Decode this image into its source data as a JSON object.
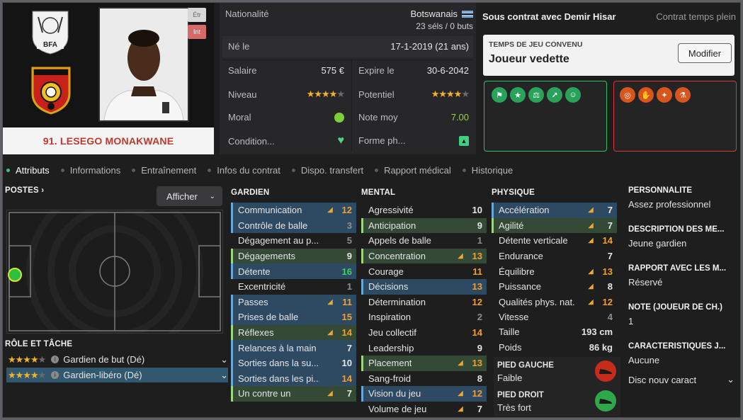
{
  "player": {
    "name": "91. LESEGO MONAKWANE",
    "tag_etr": "Étr",
    "tag_int": "Int",
    "nationality_label": "Nationalité",
    "nationality": "Botswanais",
    "caps": "23 séls / 0 buts",
    "born_label": "Né le",
    "born": "17-1-2019 (21 ans)",
    "salary_label": "Salaire",
    "salary": "575 €",
    "expires_label": "Expire le",
    "expires": "30-6-2042",
    "level_label": "Niveau",
    "level_stars": 4,
    "potential_label": "Potentiel",
    "potential_stars": 4,
    "morale_label": "Moral",
    "avg_label": "Note moy",
    "avg": "7.00",
    "condition_label": "Condition...",
    "form_label": "Forme ph..."
  },
  "badges": {
    "bfa": "BFA"
  },
  "contract": {
    "club": "Sous contrat avec Demir Hisar",
    "type": "Contrat temps plein",
    "playtime_title": "TEMPS DE JEU CONVENU",
    "playtime": "Joueur vedette",
    "modify": "Modifier"
  },
  "tabs": [
    "Attributs",
    "Informations",
    "Entraînement",
    "Infos du contrat",
    "Dispo. transfert",
    "Rapport médical",
    "Historique"
  ],
  "positions": {
    "title": "POSTES",
    "show": "Afficher"
  },
  "role": {
    "title": "RÔLE ET TÂCHE",
    "items": [
      {
        "name": "Gardien de but (Dé)",
        "stars": 4
      },
      {
        "name": "Gardien-libéro (Dé)",
        "stars": 4
      }
    ]
  },
  "goalkeeper": {
    "title": "GARDIEN",
    "attrs": [
      {
        "n": "Communication",
        "v": "12",
        "c": "orange",
        "a": true,
        "h": "blue"
      },
      {
        "n": "Contrôle de balle",
        "v": "3",
        "c": "grey",
        "a": false,
        "h": "blue"
      },
      {
        "n": "Dégagement au p...",
        "v": "5",
        "c": "grey",
        "a": false,
        "h": ""
      },
      {
        "n": "Dégagements",
        "v": "9",
        "c": "white",
        "a": false,
        "h": "green"
      },
      {
        "n": "Détente",
        "v": "16",
        "c": "green",
        "a": false,
        "h": "blue"
      },
      {
        "n": "Excentricité",
        "v": "1",
        "c": "grey",
        "a": false,
        "h": ""
      },
      {
        "n": "Passes",
        "v": "11",
        "c": "orange",
        "a": true,
        "h": "blue"
      },
      {
        "n": "Prises de balle",
        "v": "15",
        "c": "orange",
        "a": false,
        "h": "blue"
      },
      {
        "n": "Réflexes",
        "v": "14",
        "c": "orange",
        "a": true,
        "h": "green"
      },
      {
        "n": "Relances à la main",
        "v": "7",
        "c": "white",
        "a": false,
        "h": "blue"
      },
      {
        "n": "Sorties dans la su...",
        "v": "10",
        "c": "white",
        "a": false,
        "h": "blue"
      },
      {
        "n": "Sorties dans les pi...",
        "v": "14",
        "c": "orange",
        "a": false,
        "h": "blue"
      },
      {
        "n": "Un contre un",
        "v": "7",
        "c": "white",
        "a": true,
        "h": "green"
      }
    ]
  },
  "mental": {
    "title": "MENTAL",
    "attrs": [
      {
        "n": "Agressivité",
        "v": "10",
        "c": "white",
        "a": false,
        "h": ""
      },
      {
        "n": "Anticipation",
        "v": "9",
        "c": "white",
        "a": false,
        "h": "green"
      },
      {
        "n": "Appels de balle",
        "v": "1",
        "c": "grey",
        "a": false,
        "h": ""
      },
      {
        "n": "Concentration",
        "v": "13",
        "c": "orange",
        "a": true,
        "h": "green"
      },
      {
        "n": "Courage",
        "v": "11",
        "c": "orange",
        "a": false,
        "h": ""
      },
      {
        "n": "Décisions",
        "v": "13",
        "c": "orange",
        "a": false,
        "h": "blue"
      },
      {
        "n": "Détermination",
        "v": "12",
        "c": "orange",
        "a": false,
        "h": ""
      },
      {
        "n": "Inspiration",
        "v": "2",
        "c": "grey",
        "a": false,
        "h": ""
      },
      {
        "n": "Jeu collectif",
        "v": "14",
        "c": "orange",
        "a": false,
        "h": ""
      },
      {
        "n": "Leadership",
        "v": "9",
        "c": "white",
        "a": false,
        "h": ""
      },
      {
        "n": "Placement",
        "v": "13",
        "c": "orange",
        "a": true,
        "h": "green"
      },
      {
        "n": "Sang-froid",
        "v": "8",
        "c": "white",
        "a": false,
        "h": ""
      },
      {
        "n": "Vision du jeu",
        "v": "12",
        "c": "orange",
        "a": true,
        "h": "blue"
      },
      {
        "n": "Volume de jeu",
        "v": "7",
        "c": "white",
        "a": true,
        "h": ""
      }
    ]
  },
  "physical": {
    "title": "PHYSIQUE",
    "attrs": [
      {
        "n": "Accélération",
        "v": "7",
        "c": "white",
        "a": true,
        "h": "blue"
      },
      {
        "n": "Agilité",
        "v": "7",
        "c": "white",
        "a": true,
        "h": "green"
      },
      {
        "n": "Détente verticale",
        "v": "14",
        "c": "orange",
        "a": true,
        "h": ""
      },
      {
        "n": "Endurance",
        "v": "7",
        "c": "white",
        "a": false,
        "h": ""
      },
      {
        "n": "Équilibre",
        "v": "13",
        "c": "orange",
        "a": true,
        "h": ""
      },
      {
        "n": "Puissance",
        "v": "8",
        "c": "white",
        "a": true,
        "h": ""
      },
      {
        "n": "Qualités phys. nat.",
        "v": "12",
        "c": "orange",
        "a": true,
        "h": ""
      },
      {
        "n": "Vitesse",
        "v": "4",
        "c": "grey",
        "a": false,
        "h": ""
      }
    ],
    "height_label": "Taille",
    "height": "193 cm",
    "weight_label": "Poids",
    "weight": "86 kg"
  },
  "feet": {
    "left_title": "PIED GAUCHE",
    "left": "Faible",
    "right_title": "PIED DROIT",
    "right": "Très fort"
  },
  "side": [
    {
      "t": "PERSONNALITÉ",
      "d": "Assez professionnel"
    },
    {
      "t": "DESCRIPTION DES MÉ...",
      "d": "Jeune gardien"
    },
    {
      "t": "RAPPORT AVEC LES M...",
      "d": "Réservé"
    },
    {
      "t": "NOTE (JOUEUR DE CH.)",
      "d": "1"
    },
    {
      "t": "CARACTÉRISTIQUES J...",
      "d": "Aucune"
    }
  ],
  "traits_extra": "Disc nouv caract",
  "colors": {
    "accent_green": "#37c979",
    "name_red": "#c0392b",
    "good_box": "#2fbf6b",
    "bad_box": "#d73a3a"
  }
}
